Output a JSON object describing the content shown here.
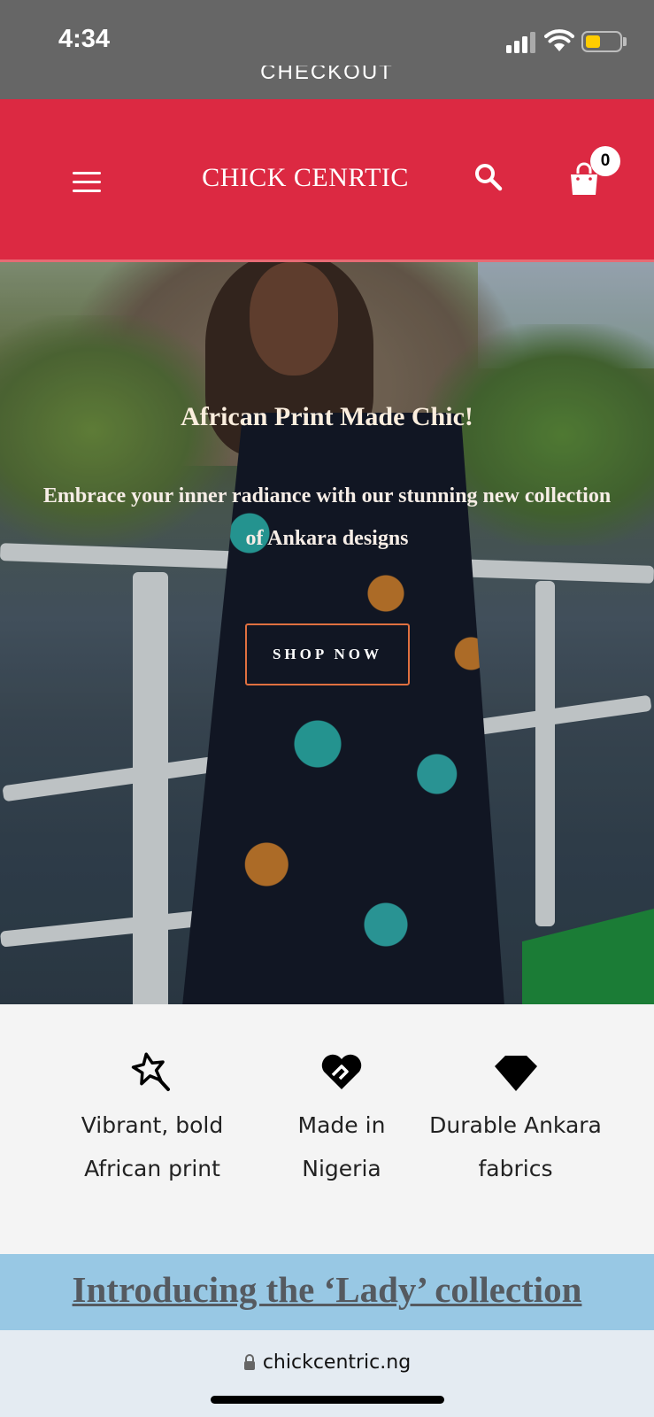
{
  "status_bar": {
    "time": "4:34",
    "signal_icon": "cellular-signal-icon",
    "wifi_icon": "wifi-icon",
    "battery_icon": "battery-icon",
    "battery_color": "#ffcc00",
    "battery_level": 0.45
  },
  "top_link": {
    "label": "CHECKOUT"
  },
  "header": {
    "brand": "CHICK CENRTIC",
    "background": "#dc2942",
    "menu_icon": "hamburger-menu-icon",
    "search_icon": "search-icon",
    "cart_icon": "shopping-bag-icon",
    "cart_count": "0"
  },
  "hero": {
    "title": "African Print Made Chic!",
    "subtitle": "Embrace your inner radiance with our stunning new collection of Ankara designs",
    "button_label": "SHOP NOW",
    "button_border_color": "#e07040"
  },
  "features": [
    {
      "icon": "magic-wand-star-icon",
      "label": "Vibrant, bold African print"
    },
    {
      "icon": "heart-handshake-icon",
      "label": "Made in Nigeria"
    },
    {
      "icon": "diamond-icon",
      "label": "Durable Ankara fabrics"
    }
  ],
  "collection_banner": {
    "label": "Introducing the ‘Lady’ collection",
    "background": "#98c8e4"
  },
  "browser_bar": {
    "lock_icon": "lock-icon",
    "url": "chickcentric.ng"
  }
}
